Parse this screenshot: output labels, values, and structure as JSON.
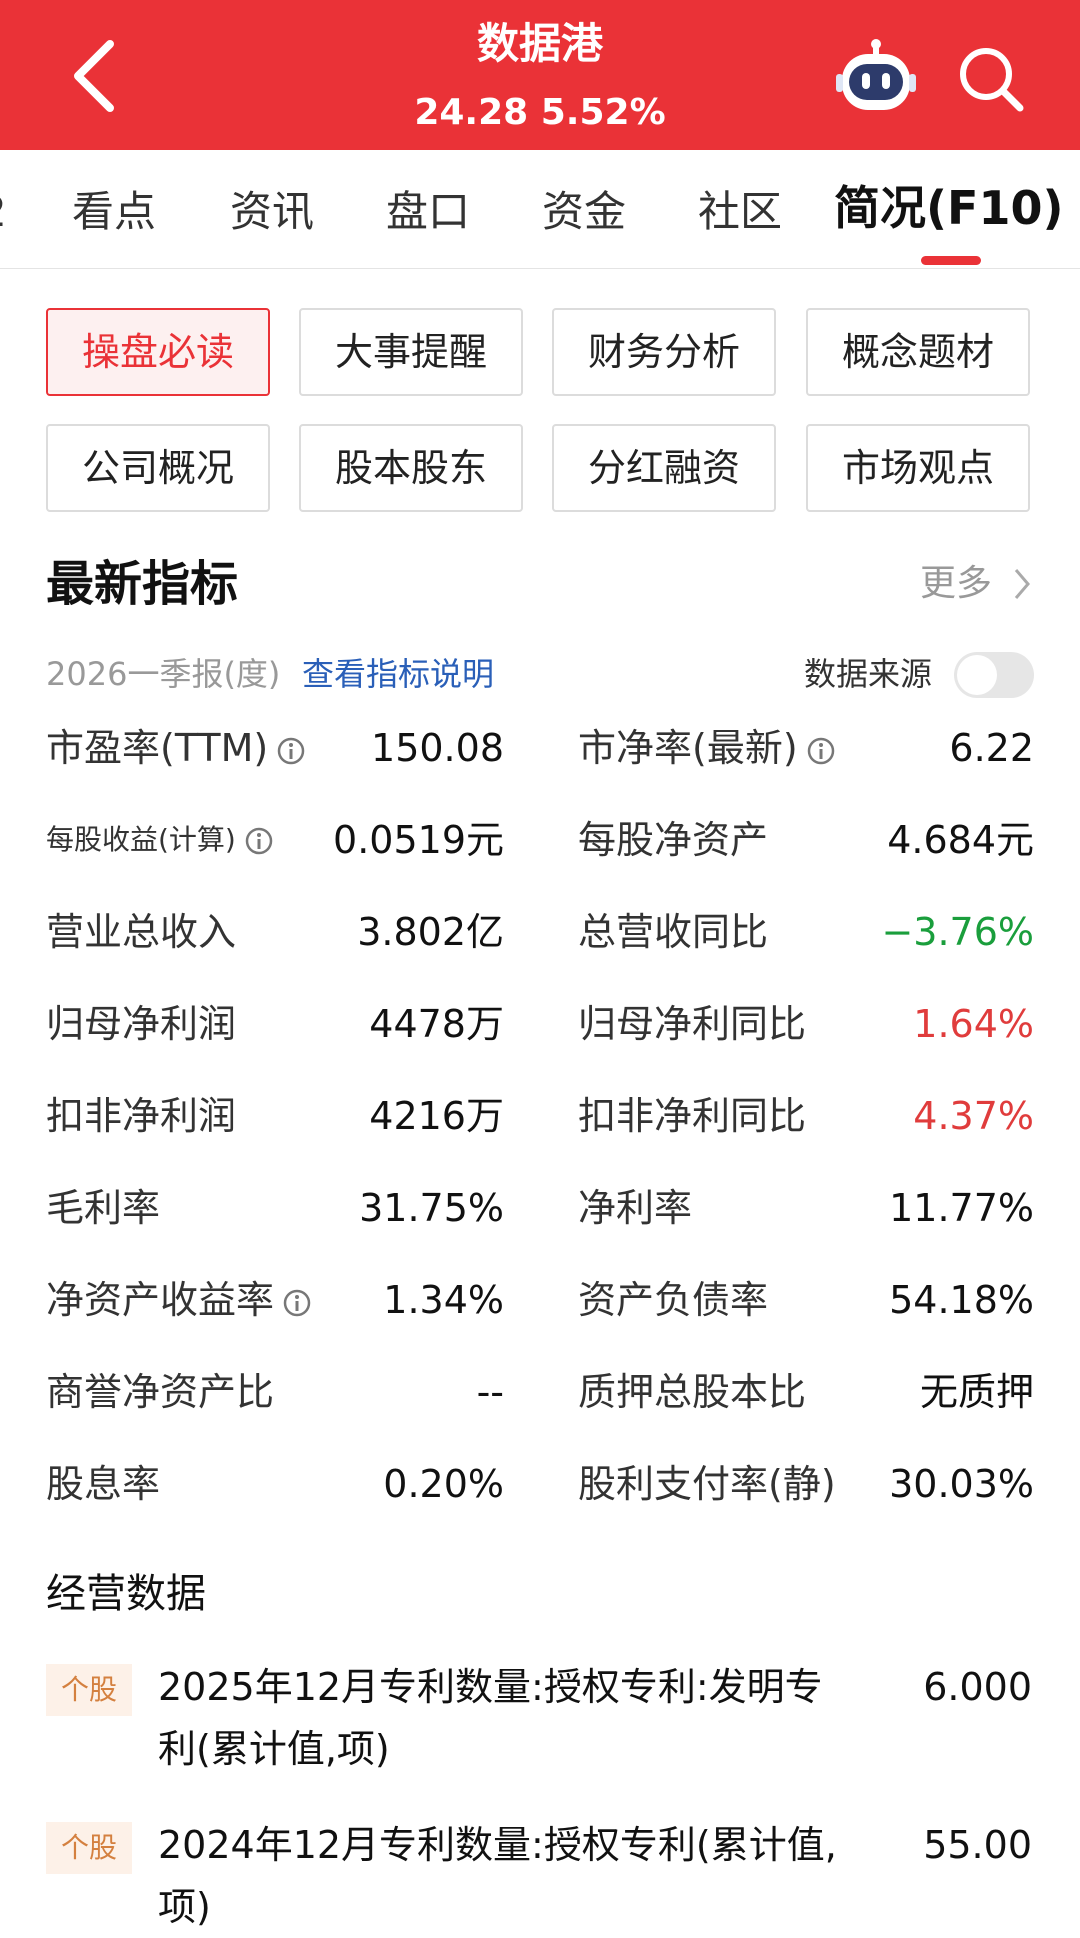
{
  "header": {
    "title": "数据港",
    "price": "24.28",
    "change": "5.52%"
  },
  "tabs": [
    {
      "label": "看点"
    },
    {
      "label": "资讯"
    },
    {
      "label": "盘口"
    },
    {
      "label": "资金"
    },
    {
      "label": "社区"
    },
    {
      "label": "简况(F10)"
    }
  ],
  "tab_cut_glyph": "2",
  "buttons": [
    {
      "label": "操盘必读"
    },
    {
      "label": "大事提醒"
    },
    {
      "label": "财务分析"
    },
    {
      "label": "概念题材"
    },
    {
      "label": "公司概况"
    },
    {
      "label": "股本股东"
    },
    {
      "label": "分红融资"
    },
    {
      "label": "市场观点"
    }
  ],
  "indicators": {
    "title": "最新指标",
    "more": "更多",
    "period": "2026一季报(度)",
    "explain_link": "查看指标说明",
    "source_label": "数据来源",
    "rows": [
      {
        "left_label": "市盈率(TTM)",
        "left_value": "150.08",
        "right_label": "市净率(最新)",
        "right_value": "6.22"
      },
      {
        "left_label": "每股收益(计算)",
        "left_value": "0.0519元",
        "right_label": "每股净资产",
        "right_value": "4.684元"
      },
      {
        "left_label": "营业总收入",
        "left_value": "3.802亿",
        "right_label": "总营收同比",
        "right_value": "−3.76%"
      },
      {
        "left_label": "归母净利润",
        "left_value": "4478万",
        "right_label": "归母净利同比",
        "right_value": "1.64%"
      },
      {
        "left_label": "扣非净利润",
        "left_value": "4216万",
        "right_label": "扣非净利同比",
        "right_value": "4.37%"
      },
      {
        "left_label": "毛利率",
        "left_value": "31.75%",
        "right_label": "净利率",
        "right_value": "11.77%"
      },
      {
        "left_label": "净资产收益率",
        "left_value": "1.34%",
        "right_label": "资产负债率",
        "right_value": "54.18%"
      },
      {
        "left_label": "商誉净资产比",
        "left_value": "--",
        "right_label": "质押总股本比",
        "right_value": "无质押"
      },
      {
        "left_label": "股息率",
        "left_value": "0.20%",
        "right_label": "股利支付率(静)",
        "right_value": "30.03%"
      }
    ]
  },
  "colors": {
    "brand_red": "#ea3237",
    "down_green": "#1a9e3c",
    "up_red": "#e03c3c",
    "link_blue": "#2a5fb8"
  },
  "operations": {
    "title": "经营数据",
    "items": [
      {
        "tag": "个股",
        "text": "2025年12月专利数量:授权专利:发明专利(累计值,项)",
        "value": "6.000"
      },
      {
        "tag": "个股",
        "text": "2024年12月专利数量:授权专利(累计值,项)",
        "value": "55.00"
      }
    ]
  }
}
